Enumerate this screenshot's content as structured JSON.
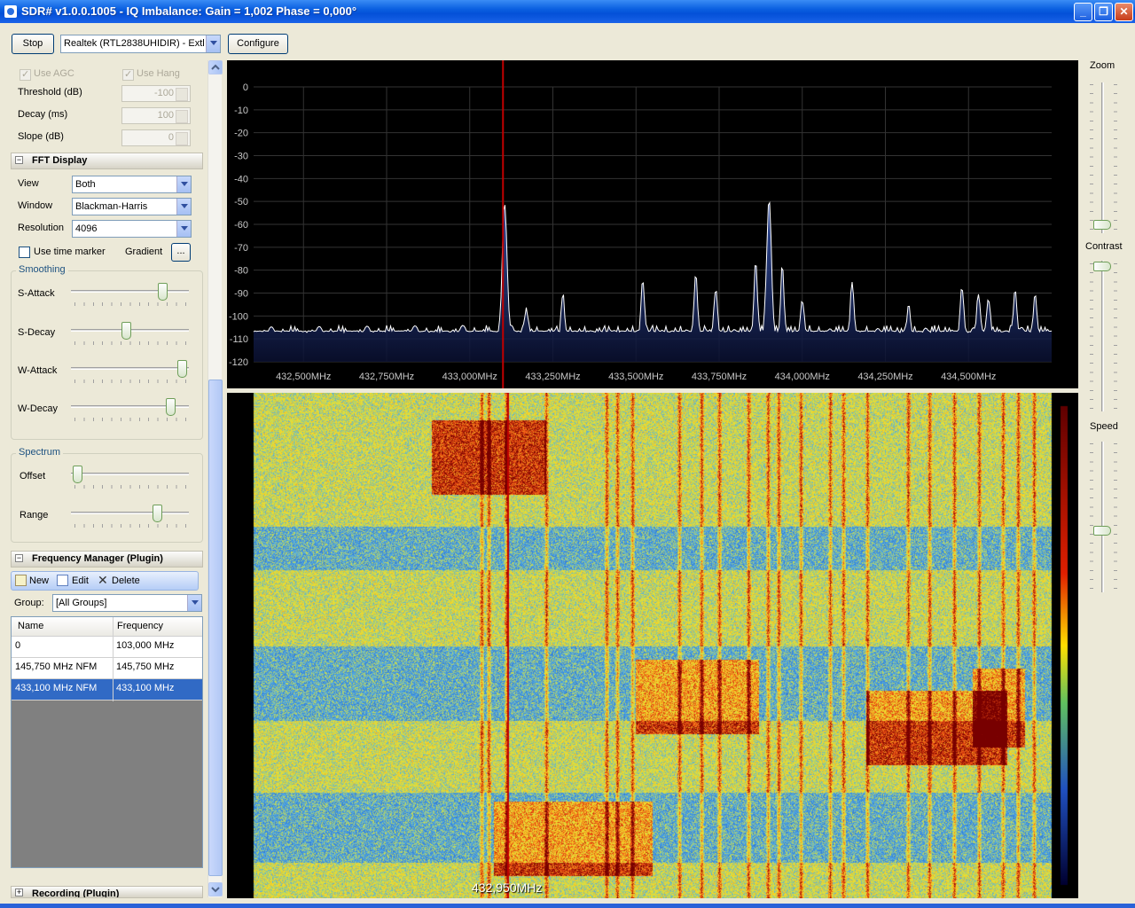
{
  "window": {
    "title": "SDR# v1.0.0.1005 - IQ Imbalance: Gain = 1,002 Phase = 0,000°"
  },
  "toolbar": {
    "stop_label": "Stop",
    "device": "Realtek (RTL2838UHIDIR) - Extl",
    "configure_label": "Configure"
  },
  "agc": {
    "use_agc": "Use AGC",
    "use_hang": "Use Hang",
    "threshold_label": "Threshold (dB)",
    "threshold_value": "-100",
    "decay_label": "Decay (ms)",
    "decay_value": "100",
    "slope_label": "Slope (dB)",
    "slope_value": "0"
  },
  "fft": {
    "header": "FFT Display",
    "view_label": "View",
    "view_value": "Both",
    "window_label": "Window",
    "window_value": "Blackman-Harris",
    "resolution_label": "Resolution",
    "resolution_value": "4096",
    "time_marker_label": "Use  time marker",
    "gradient_label": "Gradient",
    "gradient_button": "...",
    "smoothing_label": "Smoothing",
    "s_attack_label": "S-Attack",
    "s_decay_label": "S-Decay",
    "w_attack_label": "W-Attack",
    "w_decay_label": "W-Decay",
    "s_attack": 0.8,
    "s_decay": 0.47,
    "w_attack": 0.98,
    "w_decay": 0.88,
    "spectrum_label": "Spectrum",
    "offset_label": "Offset",
    "range_label": "Range",
    "offset": 0.02,
    "range": 0.75
  },
  "freq_manager": {
    "header": "Frequency Manager (Plugin)",
    "new_label": "New",
    "edit_label": "Edit",
    "delete_label": "Delete",
    "group_label": "Group:",
    "group_value": "[All Groups]",
    "columns": [
      "Name",
      "Frequency"
    ],
    "rows": [
      [
        "0",
        "103,000 MHz"
      ],
      [
        "145,750 MHz NFM",
        "145,750 MHz"
      ],
      [
        "433,100 MHz NFM",
        "433,100 MHz"
      ]
    ]
  },
  "recording": {
    "header": "Recording (Plugin)"
  },
  "right_controls": {
    "zoom_label": "Zoom",
    "contrast_label": "Contrast",
    "speed_label": "Speed",
    "zoom": 0.0,
    "contrast": 1.0,
    "speed": 0.4
  },
  "waterfall": {
    "frequency_label": "432,950MHz"
  },
  "colors": {
    "spectrum_bg": "#000000",
    "trace": "#ffffff",
    "fill": "#1a2a6a",
    "cursor": "#c00000"
  },
  "chart_data": {
    "type": "line",
    "ylim": [
      -120,
      0
    ],
    "y_ticks": [
      "0",
      "-10",
      "-20",
      "-30",
      "-40",
      "-50",
      "-60",
      "-70",
      "-80",
      "-90",
      "-100",
      "-110",
      "-120"
    ],
    "x_ticks": [
      "432,500MHz",
      "432,750MHz",
      "433,000MHz",
      "433,250MHz",
      "433,500MHz",
      "433,750MHz",
      "434,000MHz",
      "434,250MHz",
      "434,500MHz"
    ],
    "x_tick_values": [
      432.5,
      432.75,
      433.0,
      433.25,
      433.5,
      433.75,
      434.0,
      434.25,
      434.5
    ],
    "xlim": [
      432.35,
      434.75
    ],
    "cursor_mhz": 433.1,
    "noise_floor_db": -108,
    "peaks": [
      {
        "mhz": 433.105,
        "db": -50
      },
      {
        "mhz": 433.17,
        "db": -95
      },
      {
        "mhz": 433.28,
        "db": -90
      },
      {
        "mhz": 433.52,
        "db": -85
      },
      {
        "mhz": 433.68,
        "db": -81
      },
      {
        "mhz": 433.74,
        "db": -87
      },
      {
        "mhz": 433.9,
        "db": -49
      },
      {
        "mhz": 433.86,
        "db": -75
      },
      {
        "mhz": 433.94,
        "db": -78
      },
      {
        "mhz": 434.0,
        "db": -92
      },
      {
        "mhz": 434.15,
        "db": -84
      },
      {
        "mhz": 434.32,
        "db": -94
      },
      {
        "mhz": 434.48,
        "db": -86
      },
      {
        "mhz": 434.53,
        "db": -90
      },
      {
        "mhz": 434.56,
        "db": -92
      },
      {
        "mhz": 434.64,
        "db": -88
      },
      {
        "mhz": 434.7,
        "db": -90
      }
    ]
  }
}
